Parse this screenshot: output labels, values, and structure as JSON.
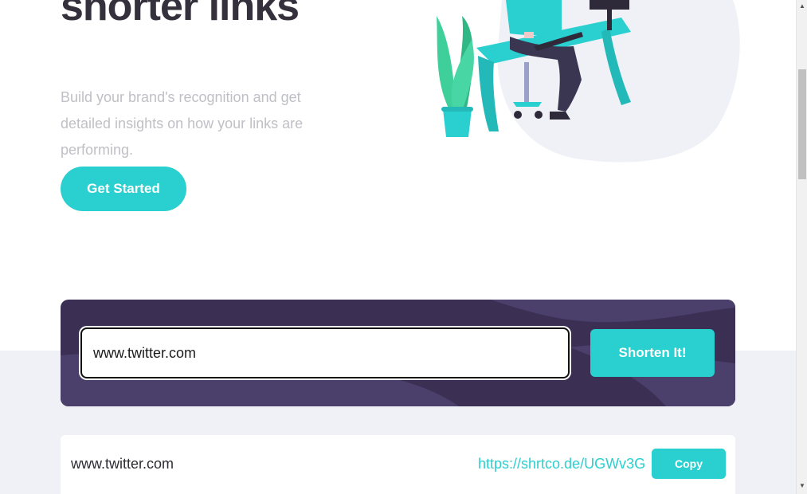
{
  "hero": {
    "title": "shorter links",
    "subtitle": "Build your brand's recognition and get detailed insights on how your links are performing.",
    "cta_label": "Get Started"
  },
  "shorten": {
    "input_value": "www.twitter.com",
    "button_label": "Shorten It!"
  },
  "results": [
    {
      "original": "www.twitter.com",
      "short": "https://shrtco.de/UGWv3G",
      "copy_label": "Copy"
    }
  ],
  "scrollbar": {
    "up_arrow": "▲",
    "down_arrow": "▼"
  },
  "colors": {
    "accent": "#2acfcf",
    "dark_violet": "#3b3054",
    "heading": "#34313d",
    "muted_text": "#bfbfc6",
    "section_bg": "#f0f1f6"
  },
  "icons": [
    "working-person-illustration",
    "plant-illustration"
  ]
}
